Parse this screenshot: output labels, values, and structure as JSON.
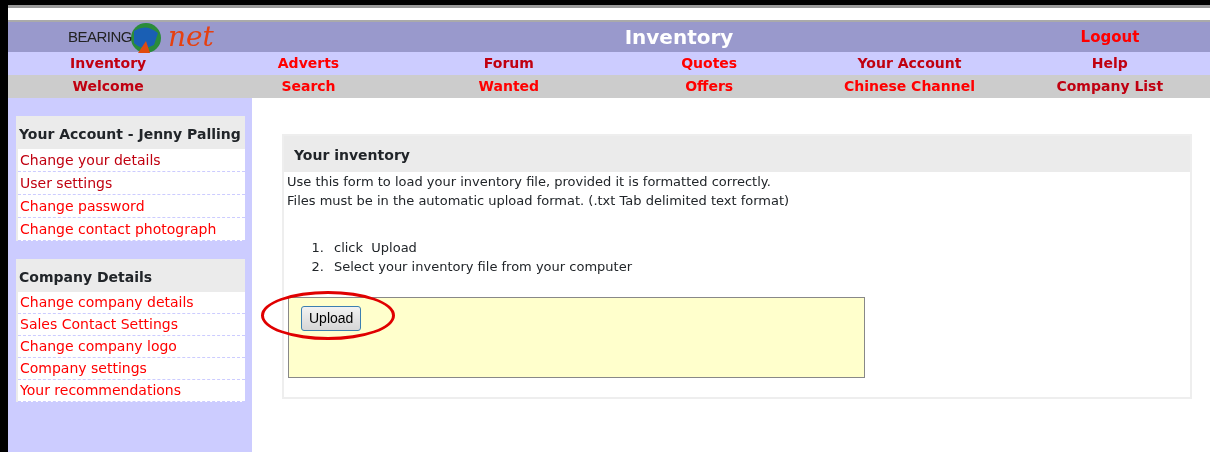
{
  "header": {
    "logo": {
      "word": "BEARING",
      "script": "net"
    },
    "title": "Inventory",
    "logout": {
      "label": "Logout",
      "visited": false
    }
  },
  "nav_rows": [
    [
      {
        "label": "Inventory",
        "visited": true
      },
      {
        "label": "Adverts",
        "visited": false
      },
      {
        "label": "Forum",
        "visited": true
      },
      {
        "label": "Quotes",
        "visited": false
      },
      {
        "label": "Your Account",
        "visited": true
      },
      {
        "label": "Help",
        "visited": true
      }
    ],
    [
      {
        "label": "Welcome",
        "visited": true
      },
      {
        "label": "Search",
        "visited": false
      },
      {
        "label": "Wanted",
        "visited": false
      },
      {
        "label": "Offers",
        "visited": false
      },
      {
        "label": "Chinese Channel",
        "visited": false
      },
      {
        "label": "Company List",
        "visited": true
      }
    ]
  ],
  "sidebar": [
    {
      "title": "Your Account - Jenny Palling",
      "links": [
        {
          "label": "Change your details",
          "visited": true
        },
        {
          "label": "User settings",
          "visited": true
        },
        {
          "label": "Change password",
          "visited": false
        },
        {
          "label": "Change contact photograph",
          "visited": false
        }
      ]
    },
    {
      "title": "Company Details",
      "links": [
        {
          "label": "Change company details",
          "visited": false
        },
        {
          "label": "Sales Contact Settings",
          "visited": false
        },
        {
          "label": "Change company logo",
          "visited": false
        },
        {
          "label": "Company settings",
          "visited": false
        },
        {
          "label": "Your recommendations",
          "visited": false
        }
      ]
    }
  ],
  "panel": {
    "title": "Your inventory",
    "intro": [
      "Use this form to load your inventory file, provided it is formatted correctly.",
      "Files must be in the automatic upload format. (.txt Tab delimited text format)"
    ],
    "steps": [
      {
        "marker": "1.",
        "text": "click  Upload"
      },
      {
        "marker": "2.",
        "text": "Select your inventory file from your computer"
      }
    ],
    "upload_button": {
      "label": "Upload",
      "highlighted": true
    }
  }
}
